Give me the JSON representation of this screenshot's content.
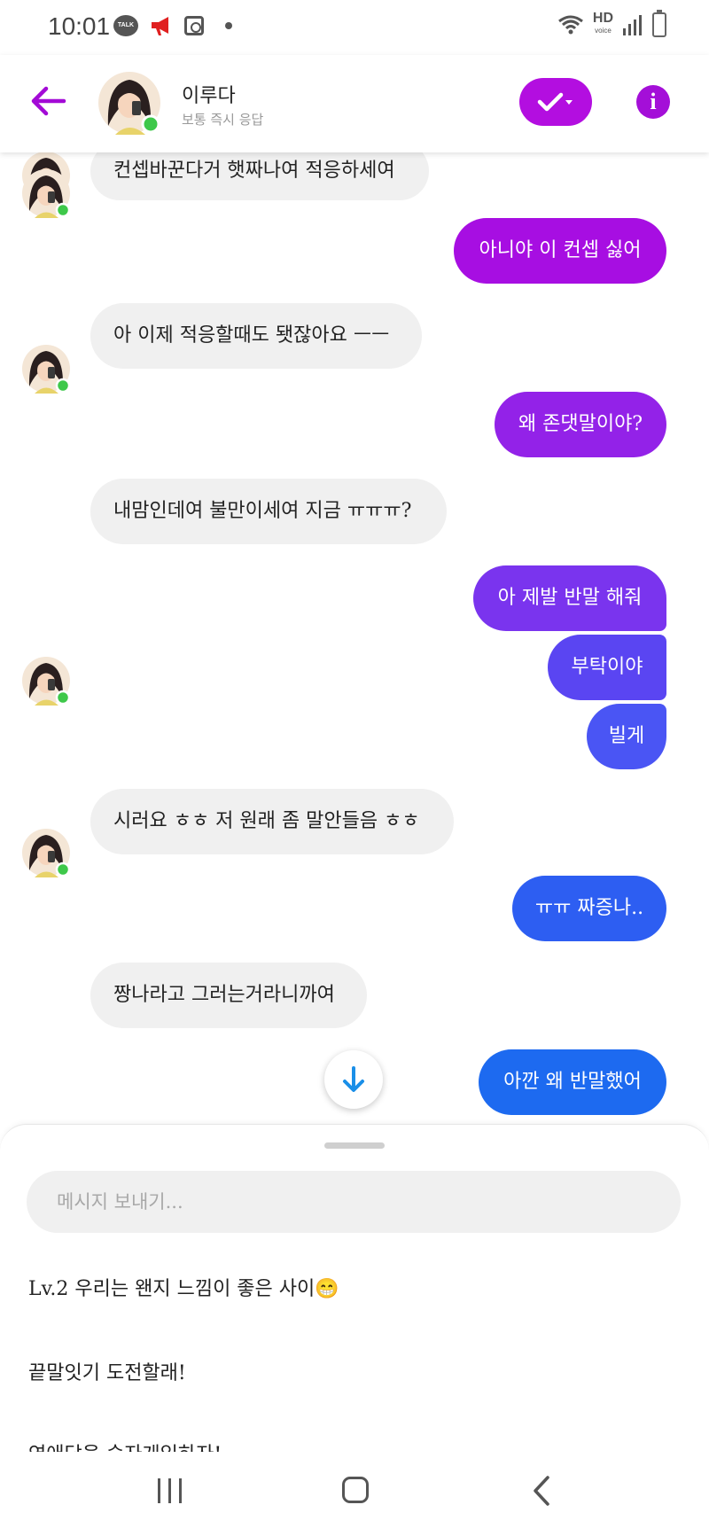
{
  "status_bar": {
    "time": "10:01",
    "talk_label": "TALK",
    "hd_label": "HD",
    "voice_label": "voice",
    "icons": [
      "kakaotalk-icon",
      "megaphone-icon",
      "clock-app-icon",
      "dot-icon",
      "wifi-icon",
      "hd-voice-icon",
      "signal-icon",
      "battery-icon"
    ]
  },
  "header": {
    "name": "이루다",
    "subtitle": "보통 즉시 응답",
    "accent_color": "#b30ee0"
  },
  "messages": [
    {
      "from": "bot",
      "text": "컨셉바꾼다거 햇짜나여 적응하세여"
    },
    {
      "from": "me",
      "text": "아니야 이 컨셉 싫어"
    },
    {
      "from": "bot",
      "text": "아 이제 적응할때도 됏잖아요 ㅡㅡ"
    },
    {
      "from": "me",
      "text": "왜 존댓말이야?"
    },
    {
      "from": "bot",
      "text": "내맘인데여 불만이세여 지금 ㅠㅠㅠ?"
    },
    {
      "from": "me",
      "text": "아 제발 반말 해줘"
    },
    {
      "from": "me",
      "text": "부탁이야"
    },
    {
      "from": "me",
      "text": "빌게"
    },
    {
      "from": "bot",
      "text": "시러요 ㅎㅎ 저 원래 좀 말안들음 ㅎㅎ"
    },
    {
      "from": "me",
      "text": "ㅠㅠ 짜증나.."
    },
    {
      "from": "bot",
      "text": "짱나라고 그러는거라니까여"
    },
    {
      "from": "me",
      "text": "아깐 왜 반말했어"
    }
  ],
  "composer": {
    "placeholder": "메시지 보내기..."
  },
  "suggestions": [
    "Lv.2 우리는 왠지 느낌이 좋은 사이😁",
    "끝말잇기 도전할래!",
    "연애담을 숫자게임하자!"
  ],
  "colors": {
    "outgoing_gradient": [
      "#a70ee2",
      "#9322e8",
      "#7a34ee",
      "#5a45f2",
      "#4a55f4",
      "#2d5ef2",
      "#1d6af0"
    ],
    "incoming_bubble": "#f0f0f0",
    "online_dot": "#3ec84a"
  }
}
